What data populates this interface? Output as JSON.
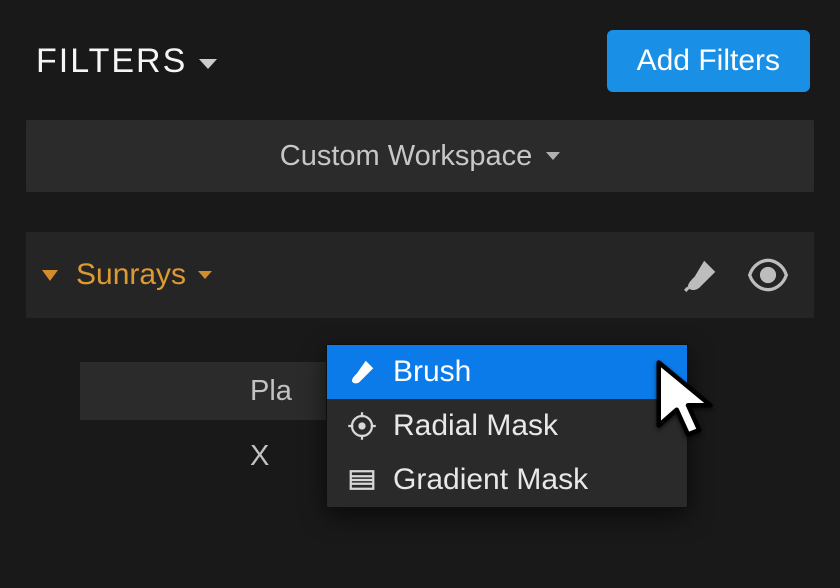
{
  "header": {
    "title": "FILTERS",
    "add_button": "Add Filters"
  },
  "workspace": {
    "label": "Custom Workspace"
  },
  "filter": {
    "name": "Sunrays"
  },
  "placeholder_row": "Pla",
  "axis_label": "X",
  "mask_menu": {
    "items": [
      {
        "label": "Brush"
      },
      {
        "label": "Radial Mask"
      },
      {
        "label": "Gradient Mask"
      }
    ]
  }
}
